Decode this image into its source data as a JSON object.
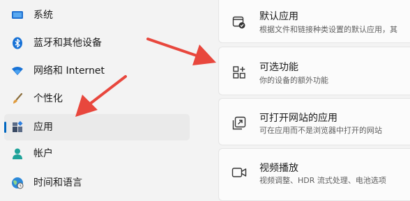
{
  "sidebar": {
    "items": [
      {
        "label": "系统",
        "icon": "monitor-icon"
      },
      {
        "label": "蓝牙和其他设备",
        "icon": "bluetooth-icon"
      },
      {
        "label": "网络和 Internet",
        "icon": "wifi-icon"
      },
      {
        "label": "个性化",
        "icon": "brush-icon"
      },
      {
        "label": "应用",
        "icon": "apps-icon",
        "selected": true
      },
      {
        "label": "帐户",
        "icon": "person-icon"
      },
      {
        "label": "时间和语言",
        "icon": "globe-clock-icon"
      }
    ]
  },
  "main": {
    "cards": [
      {
        "title": "默认应用",
        "subtitle": "根据文件和链接种类设置的默认应用，其",
        "icon": "default-apps-icon"
      },
      {
        "title": "可选功能",
        "subtitle": "你的设备的额外功能",
        "icon": "optional-features-icon"
      },
      {
        "title": "可打开网站的应用",
        "subtitle": "可在应用而不是浏览器中打开的网站",
        "icon": "apps-for-websites-icon"
      },
      {
        "title": "视频播放",
        "subtitle": "视频调整、HDR 流式处理、电池选项",
        "icon": "video-playback-icon"
      }
    ]
  },
  "colors": {
    "accent": "#0067c0",
    "arrow": "#e8473d"
  }
}
